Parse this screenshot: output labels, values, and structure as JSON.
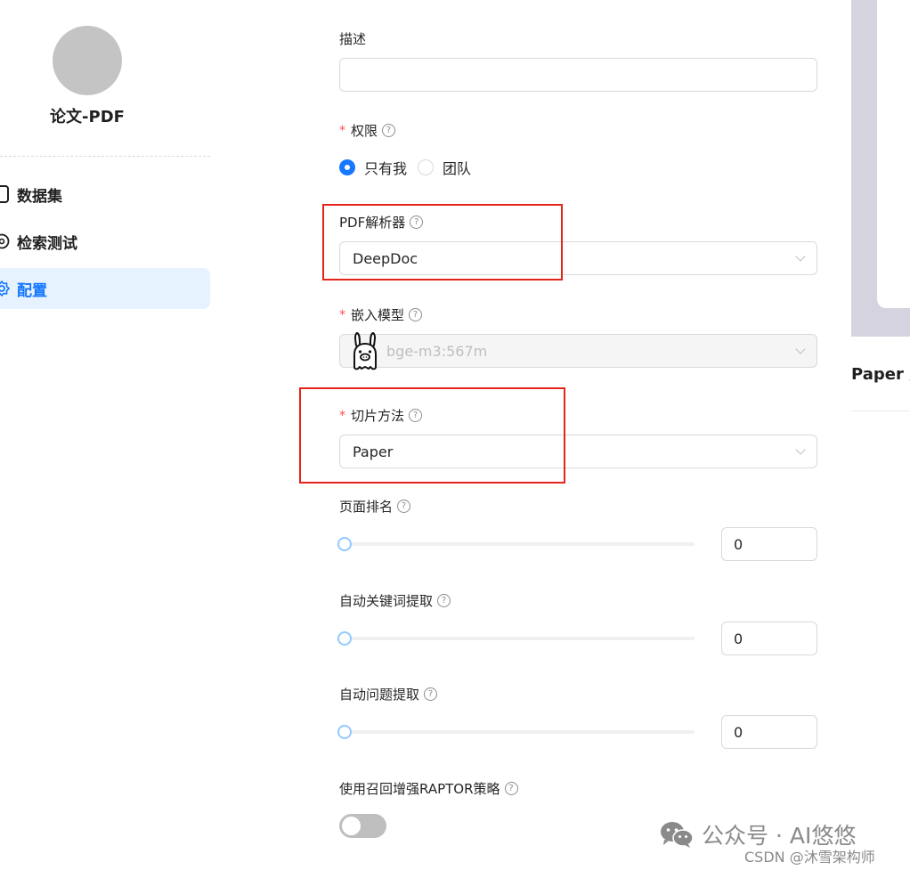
{
  "sidebar": {
    "kb_name": "论文-PDF",
    "items": [
      {
        "label": "数据集",
        "icon": "dataset-icon",
        "active": false
      },
      {
        "label": "检索测试",
        "icon": "retrieval-test-icon",
        "active": false
      },
      {
        "label": "配置",
        "icon": "gear-icon",
        "active": true
      }
    ]
  },
  "form": {
    "description": {
      "label": "描述",
      "value": ""
    },
    "permission": {
      "label": "权限",
      "help": "?",
      "options": [
        {
          "label": "只有我",
          "checked": true
        },
        {
          "label": "团队",
          "checked": false
        }
      ]
    },
    "pdf_parser": {
      "label": "PDF解析器",
      "help": "?",
      "value": "DeepDoc"
    },
    "embedding_model": {
      "label": "嵌入模型",
      "help": "?",
      "value": "bge-m3:567m",
      "icon": "llama-icon",
      "disabled": true
    },
    "chunk_method": {
      "label": "切片方法",
      "help": "?",
      "value": "Paper"
    },
    "page_rank": {
      "label": "页面排名",
      "help": "?",
      "value": "0",
      "slider_fraction": 0
    },
    "auto_keywords": {
      "label": "自动关键词提取",
      "help": "?",
      "value": "0",
      "slider_fraction": 0
    },
    "auto_questions": {
      "label": "自动问题提取",
      "help": "?",
      "value": "0",
      "slider_fraction": 0
    },
    "raptor": {
      "label": "使用召回增强RAPTOR策略",
      "help": "?",
      "enabled": false
    }
  },
  "preview": {
    "title": "Paper 方"
  },
  "colors": {
    "accent": "#1677ff",
    "active_nav_bg": "#e6f2ff",
    "highlight_box": "#e5251b",
    "required_star": "#ff4d4f"
  },
  "watermarks": {
    "wechat": "公众号 · AI悠悠",
    "csdn": "CSDN @沐雪架构师"
  }
}
